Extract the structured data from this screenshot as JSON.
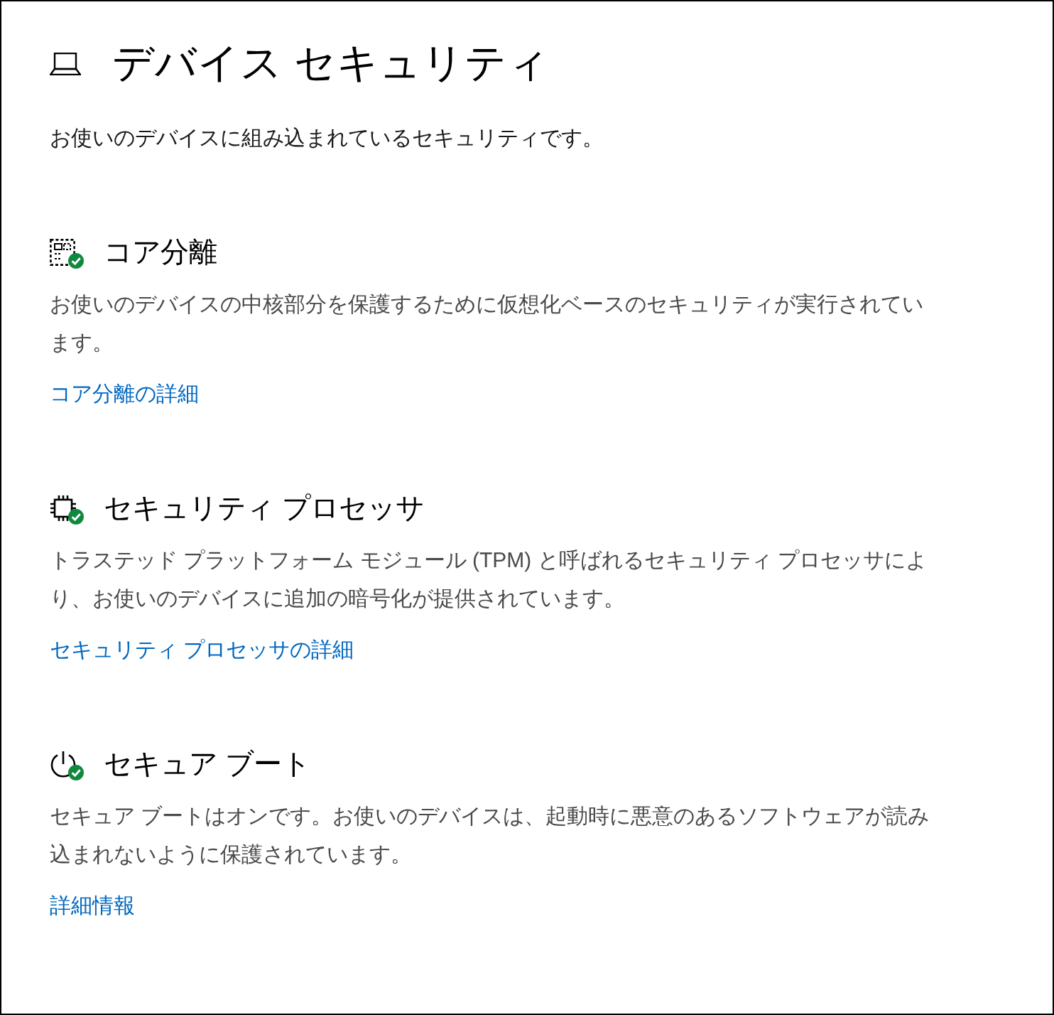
{
  "page": {
    "title": "デバイス セキュリティ",
    "subtitle": "お使いのデバイスに組み込まれているセキュリティです。"
  },
  "sections": [
    {
      "kind": "isolation",
      "title": "コア分離",
      "protected": true,
      "description": "お使いのデバイスの中核部分を保護するために仮想化ベースのセキュリティが実行されています。",
      "link": "コア分離の詳細"
    },
    {
      "kind": "processor",
      "title": "セキュリティ プロセッサ",
      "protected": true,
      "description": "トラステッド プラットフォーム モジュール (TPM) と呼ばれるセキュリティ プロセッサにより、お使いのデバイスに追加の暗号化が提供されています。",
      "link": "セキュリティ プロセッサの詳細"
    },
    {
      "kind": "boot",
      "title": "セキュア ブート",
      "protected": true,
      "description": "セキュア ブートはオンです。お使いのデバイスは、起動時に悪意のあるソフトウェアが読み込まれないように保護されています。",
      "link": "詳細情報"
    }
  ]
}
